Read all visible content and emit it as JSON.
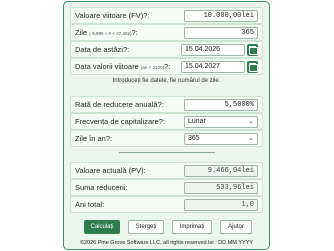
{
  "fields": {
    "future_value": {
      "label": "Valoare viitoare (FV)?:",
      "value": "10.000,00lei"
    },
    "days": {
      "label": "Zile",
      "hint": "(-9,999 < # < 47,482)",
      "suffix": "?:",
      "value": "365"
    },
    "today_date": {
      "label": "Data de astăzi?:",
      "value": "15.04.2026"
    },
    "future_date": {
      "label": "Data valorii viitoare",
      "hint": "(an < 2100)",
      "suffix": "?:",
      "value": "15.04.2027"
    },
    "info": "Introduceți fie datele, fie numărul de zile.",
    "discount_rate": {
      "label": "Rată de reducere anuală?:",
      "value": "5,5000%"
    },
    "compounding": {
      "label": "Frecvența de capitalizare?:",
      "value": "Lunar"
    },
    "days_per_year": {
      "label": "Zile în an?:",
      "value": "365"
    },
    "present_value": {
      "label": "Valoare actuală (PV):",
      "value": "9.466,04lei"
    },
    "total_discount": {
      "label": "Suma reducerii:",
      "value": "533,96lei"
    },
    "years": {
      "label": "Ani total:",
      "value": "1,0"
    }
  },
  "buttons": {
    "calculate": "Calculați",
    "clear": "Ștergeți",
    "print": "Imprimați",
    "help": "Ajutor"
  },
  "footer": "©2026 Pine Grove Software LLC, all rights reserved lei : DD.MM.YYYY",
  "colors": {
    "accent": "#2f7d4f",
    "frame_border": "#3f8f5f",
    "frame_bg": "#eaf6ee"
  }
}
